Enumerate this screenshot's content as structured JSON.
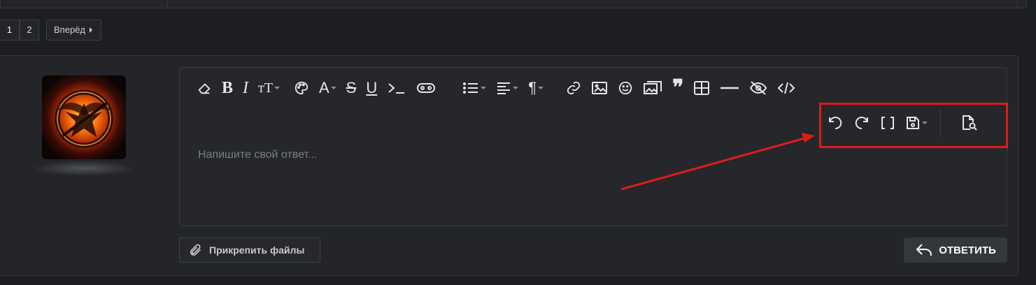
{
  "pagination": {
    "pages": [
      "1",
      "2"
    ],
    "current": "1",
    "next_label": "Вперёд"
  },
  "avatar": {
    "alt": "user-avatar"
  },
  "toolbar": {
    "main_icons": [
      "eraser-icon",
      "bold-icon",
      "italic-icon",
      "font-size-icon",
      "palette-icon",
      "font-color-icon",
      "strikethrough-icon",
      "underline-icon",
      "code-inline-icon",
      "gamepad-icon",
      "list-icon",
      "align-icon",
      "paragraph-icon",
      "link-icon",
      "image-icon",
      "smile-icon",
      "gallery-icon",
      "quote-icon",
      "table-icon",
      "hr-icon",
      "hide-icon",
      "code-icon"
    ],
    "secondary_icons": [
      "undo-icon",
      "redo-icon",
      "brackets-icon",
      "save-draft-icon",
      "preview-icon"
    ]
  },
  "editor": {
    "placeholder": "Напишите свой ответ..."
  },
  "actions": {
    "attach_label": "Прикрепить файлы",
    "submit_label": "ОТВЕТИТЬ"
  },
  "colors": {
    "background": "#1c1e21",
    "panel": "#232528",
    "annotation": "#e01b1b"
  }
}
